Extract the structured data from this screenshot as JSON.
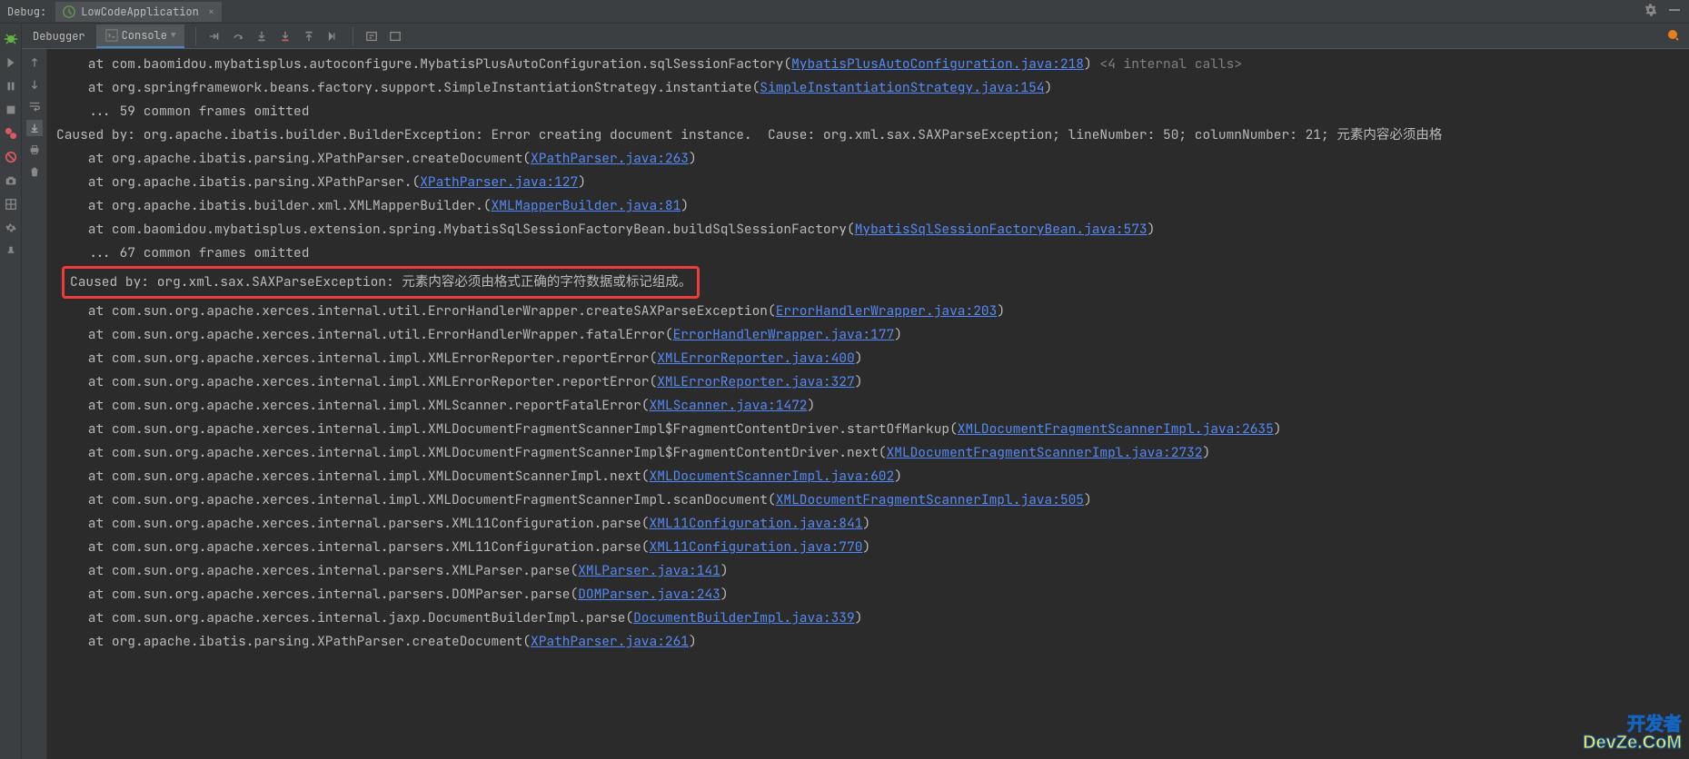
{
  "topbar": {
    "debug_label": "Debug:",
    "tab_name": "LowCodeApplication",
    "close": "×"
  },
  "tabs": {
    "debugger": "Debugger",
    "console": "Console"
  },
  "watermark": {
    "line1": "开发者",
    "line2": "DevZe.CoM"
  },
  "logs": [
    {
      "indent": 2,
      "prefix": "at com.baomidou.mybatisplus.autoconfigure.MybatisPlusAutoConfiguration.sqlSessionFactory(",
      "link": "MybatisPlusAutoConfiguration.java:218",
      "suffix": ") ",
      "tail": "<4 internal calls>"
    },
    {
      "indent": 2,
      "prefix": "at org.springframework.beans.factory.support.SimpleInstantiationStrategy.instantiate(",
      "link": "SimpleInstantiationStrategy.java:154",
      "suffix": ")"
    },
    {
      "indent": 2,
      "prefix": "... 59 common frames omitted"
    },
    {
      "indent": 0,
      "prefix": "Caused by: org.apache.ibatis.builder.BuilderException: Error creating document instance.  Cause: org.xml.sax.SAXParseException; lineNumber: 50; columnNumber: 21; 元素内容必须由格"
    },
    {
      "indent": 2,
      "prefix": "at org.apache.ibatis.parsing.XPathParser.createDocument(",
      "link": "XPathParser.java:263",
      "suffix": ")"
    },
    {
      "indent": 2,
      "prefix": "at org.apache.ibatis.parsing.XPathParser.<init>(",
      "link": "XPathParser.java:127",
      "suffix": ")"
    },
    {
      "indent": 2,
      "prefix": "at org.apache.ibatis.builder.xml.XMLMapperBuilder.<init>(",
      "link": "XMLMapperBuilder.java:81",
      "suffix": ")"
    },
    {
      "indent": 2,
      "prefix": "at com.baomidou.mybatisplus.extension.spring.MybatisSqlSessionFactoryBean.buildSqlSessionFactory(",
      "link": "MybatisSqlSessionFactoryBean.java:573",
      "suffix": ")"
    },
    {
      "indent": 2,
      "prefix": "... 67 common frames omitted"
    },
    {
      "highlight": true,
      "prefix": "Caused by: org.xml.sax.SAXParseException: 元素内容必须由格式正确的字符数据或标记组成。"
    },
    {
      "indent": 2,
      "prefix": "at com.sun.org.apache.xerces.internal.util.ErrorHandlerWrapper.createSAXParseException(",
      "link": "ErrorHandlerWrapper.java:203",
      "suffix": ")"
    },
    {
      "indent": 2,
      "prefix": "at com.sun.org.apache.xerces.internal.util.ErrorHandlerWrapper.fatalError(",
      "link": "ErrorHandlerWrapper.java:177",
      "suffix": ")"
    },
    {
      "indent": 2,
      "prefix": "at com.sun.org.apache.xerces.internal.impl.XMLErrorReporter.reportError(",
      "link": "XMLErrorReporter.java:400",
      "suffix": ")"
    },
    {
      "indent": 2,
      "prefix": "at com.sun.org.apache.xerces.internal.impl.XMLErrorReporter.reportError(",
      "link": "XMLErrorReporter.java:327",
      "suffix": ")"
    },
    {
      "indent": 2,
      "prefix": "at com.sun.org.apache.xerces.internal.impl.XMLScanner.reportFatalError(",
      "link": "XMLScanner.java:1472",
      "suffix": ")"
    },
    {
      "indent": 2,
      "prefix": "at com.sun.org.apache.xerces.internal.impl.XMLDocumentFragmentScannerImpl$FragmentContentDriver.startOfMarkup(",
      "link": "XMLDocumentFragmentScannerImpl.java:2635",
      "suffix": ")"
    },
    {
      "indent": 2,
      "prefix": "at com.sun.org.apache.xerces.internal.impl.XMLDocumentFragmentScannerImpl$FragmentContentDriver.next(",
      "link": "XMLDocumentFragmentScannerImpl.java:2732",
      "suffix": ")"
    },
    {
      "indent": 2,
      "prefix": "at com.sun.org.apache.xerces.internal.impl.XMLDocumentScannerImpl.next(",
      "link": "XMLDocumentScannerImpl.java:602",
      "suffix": ")"
    },
    {
      "indent": 2,
      "prefix": "at com.sun.org.apache.xerces.internal.impl.XMLDocumentFragmentScannerImpl.scanDocument(",
      "link": "XMLDocumentFragmentScannerImpl.java:505",
      "suffix": ")"
    },
    {
      "indent": 2,
      "prefix": "at com.sun.org.apache.xerces.internal.parsers.XML11Configuration.parse(",
      "link": "XML11Configuration.java:841",
      "suffix": ")"
    },
    {
      "indent": 2,
      "prefix": "at com.sun.org.apache.xerces.internal.parsers.XML11Configuration.parse(",
      "link": "XML11Configuration.java:770",
      "suffix": ")"
    },
    {
      "indent": 2,
      "prefix": "at com.sun.org.apache.xerces.internal.parsers.XMLParser.parse(",
      "link": "XMLParser.java:141",
      "suffix": ")"
    },
    {
      "indent": 2,
      "prefix": "at com.sun.org.apache.xerces.internal.parsers.DOMParser.parse(",
      "link": "DOMParser.java:243",
      "suffix": ")"
    },
    {
      "indent": 2,
      "prefix": "at com.sun.org.apache.xerces.internal.jaxp.DocumentBuilderImpl.parse(",
      "link": "DocumentBuilderImpl.java:339",
      "suffix": ")"
    },
    {
      "indent": 2,
      "prefix": "at org.apache.ibatis.parsing.XPathParser.createDocument(",
      "link": "XPathParser.java:261",
      "suffix": ")"
    }
  ]
}
